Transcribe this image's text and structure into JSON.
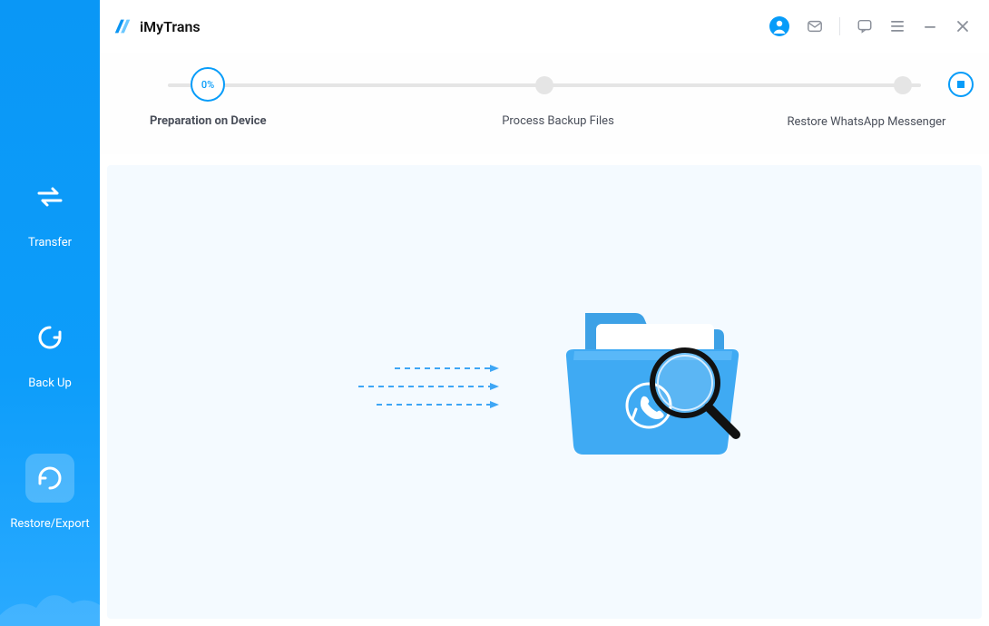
{
  "app": {
    "title": "iMyTrans"
  },
  "sidebar": {
    "items": [
      {
        "label": "Transfer"
      },
      {
        "label": "Back Up"
      },
      {
        "label": "Restore/Export"
      }
    ]
  },
  "steps": {
    "percent": "0%",
    "labels": {
      "s1": "Preparation on Device",
      "s2": "Process Backup Files",
      "s3": "Restore WhatsApp Messenger"
    }
  }
}
